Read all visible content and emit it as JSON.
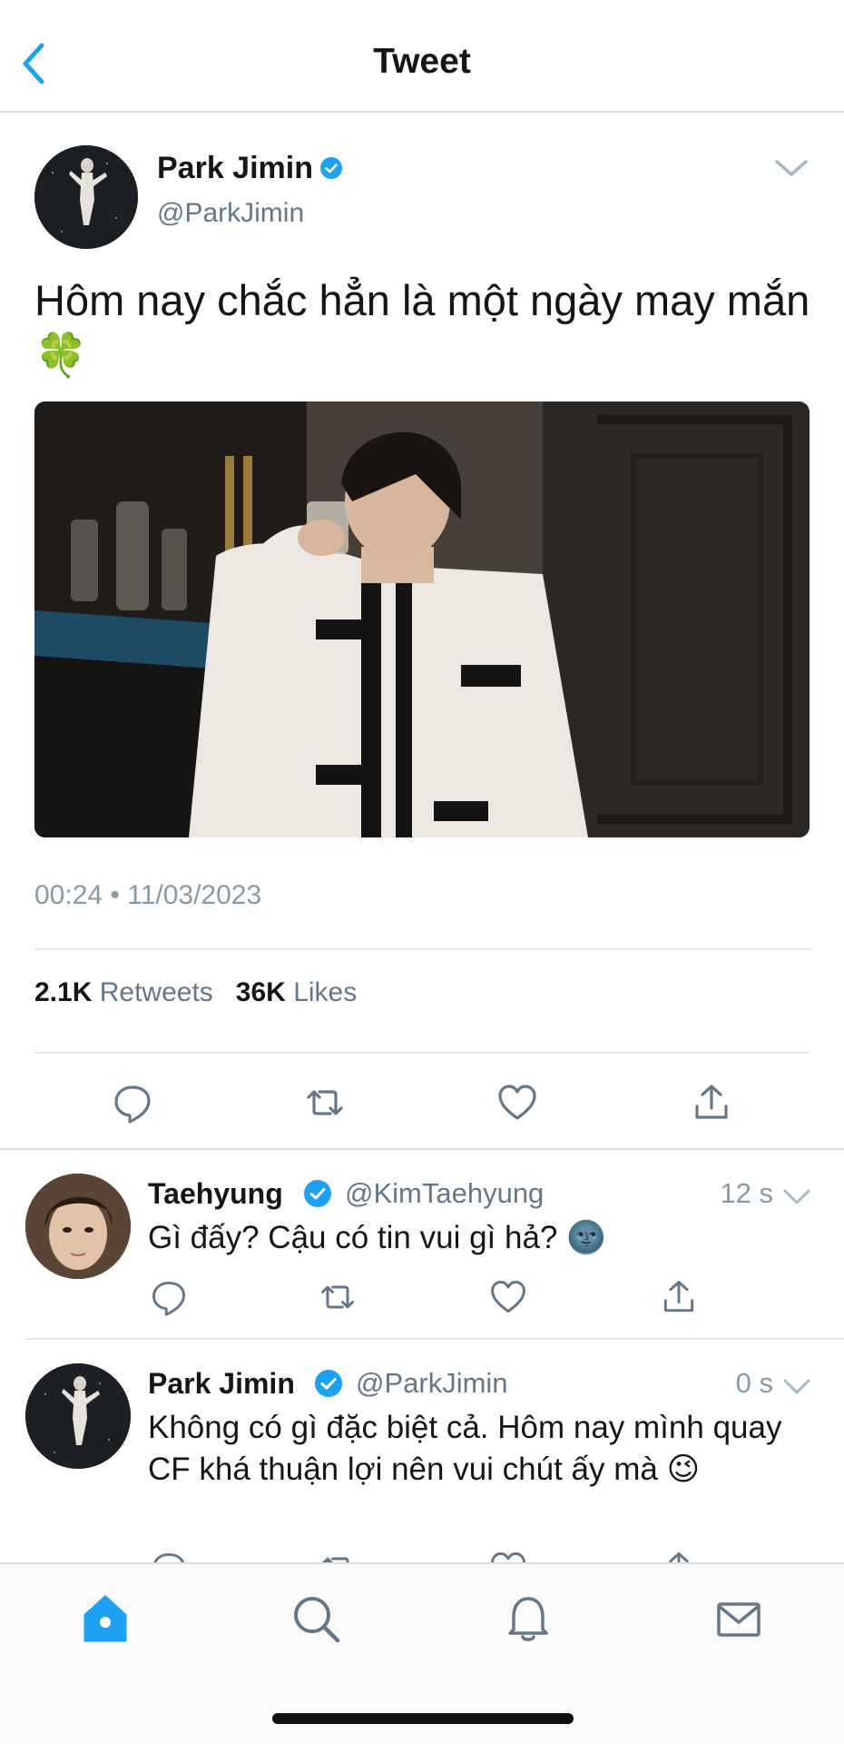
{
  "header": {
    "title": "Tweet"
  },
  "main_tweet": {
    "author_name": "Park Jimin",
    "author_handle": "@ParkJimin",
    "text": "Hôm nay chắc hẳn là một ngày may mắn 🍀",
    "timestamp": "00:24 • 11/03/2023",
    "retweets_count": "2.1K",
    "retweets_label": "Retweets",
    "likes_count": "36K",
    "likes_label": "Likes"
  },
  "replies": [
    {
      "author_name": "Taehyung",
      "author_handle": "@KimTaehyung",
      "time": "12 s",
      "text": "Gì đấy? Cậu có tin vui gì hả? 🌚"
    },
    {
      "author_name": "Park Jimin",
      "author_handle": "@ParkJimin",
      "time": "0 s",
      "text": "Không có gì đặc biệt cả. Hôm nay mình quay CF khá thuận lợi nên vui chút ấy mà 😉"
    }
  ],
  "icons": {
    "back": "chevron-left-icon",
    "caret": "chevron-down-icon",
    "verified": "verified-badge-icon",
    "reply": "reply-icon",
    "retweet": "retweet-icon",
    "like": "heart-icon",
    "share": "share-icon",
    "home": "home-icon",
    "search": "search-icon",
    "notifications": "bell-icon",
    "messages": "mail-icon"
  },
  "colors": {
    "accent": "#1da1f2",
    "text_primary": "#14171a",
    "text_secondary": "#657786",
    "divider": "#e1e8ed"
  }
}
